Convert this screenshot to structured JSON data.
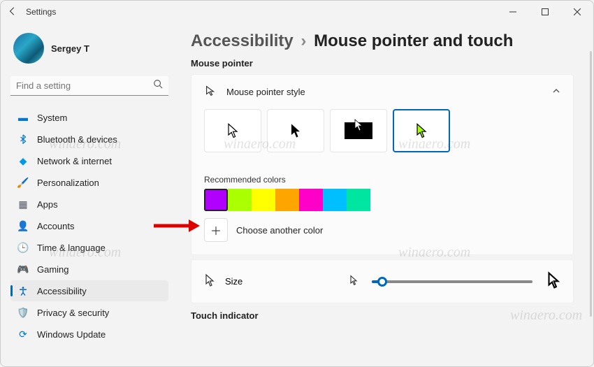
{
  "titlebar": {
    "back_tooltip": "Back",
    "title": "Settings"
  },
  "profile": {
    "name": "Sergey T"
  },
  "search": {
    "placeholder": "Find a setting"
  },
  "sidebar": {
    "items": [
      {
        "label": "System",
        "icon": "💻"
      },
      {
        "label": "Bluetooth & devices",
        "icon": "bt"
      },
      {
        "label": "Network & internet",
        "icon": "📶"
      },
      {
        "label": "Personalization",
        "icon": "🖌️"
      },
      {
        "label": "Apps",
        "icon": "▦"
      },
      {
        "label": "Accounts",
        "icon": "👤"
      },
      {
        "label": "Time & language",
        "icon": "🕒"
      },
      {
        "label": "Gaming",
        "icon": "🎮"
      },
      {
        "label": "Accessibility",
        "icon": "acc"
      },
      {
        "label": "Privacy & security",
        "icon": "🛡️"
      },
      {
        "label": "Windows Update",
        "icon": "🔄"
      }
    ],
    "active_index": 8
  },
  "breadcrumb": {
    "parent": "Accessibility",
    "current": "Mouse pointer and touch"
  },
  "sections": {
    "mouse_pointer": "Mouse pointer",
    "touch_indicator": "Touch indicator"
  },
  "pointer_style": {
    "header": "Mouse pointer style",
    "options": [
      "white",
      "black",
      "inverted",
      "custom"
    ],
    "selected_index": 3
  },
  "recommended": {
    "label": "Recommended colors",
    "colors": [
      "#b000ff",
      "#aaff00",
      "#ffff00",
      "#ffa500",
      "#ff00c8",
      "#00bfff",
      "#00e5a0"
    ],
    "selected_index": 0,
    "choose_label": "Choose another color"
  },
  "size": {
    "label": "Size",
    "value": 1,
    "min": 1,
    "max": 15
  },
  "watermark": "winaero.com"
}
